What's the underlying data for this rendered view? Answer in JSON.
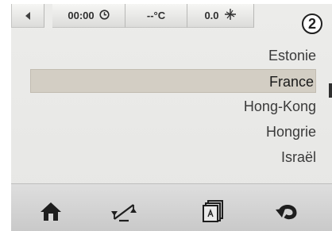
{
  "status": {
    "clock": "00:00",
    "temperature": "--°C",
    "fan": "0.0"
  },
  "page_number": "2",
  "list": {
    "items": [
      "Estonie",
      "France",
      "Hong-Kong",
      "Hongrie",
      "Israël"
    ],
    "selected": "France"
  },
  "icons": {
    "back": "back-arrow-icon",
    "clock": "clock-icon",
    "fan": "fan-icon",
    "home": "home-icon",
    "balance": "balance-icon",
    "cards": "cards-icon",
    "return": "return-icon"
  },
  "colors": {
    "background": "#e9e9e7",
    "selection": "#d3cec4",
    "text": "#3a3a3a"
  }
}
